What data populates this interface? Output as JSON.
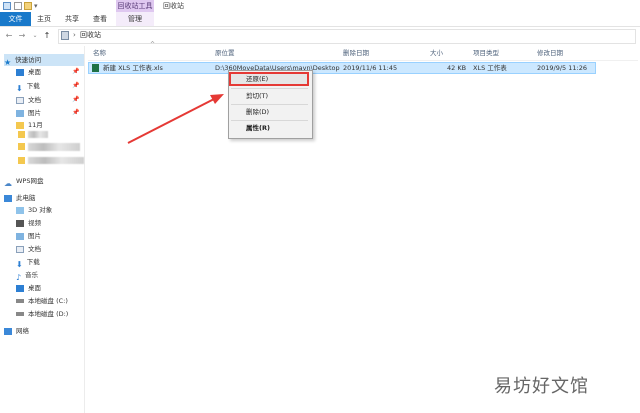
{
  "window": {
    "context_tab_header": "回收站工具",
    "title": "回收站"
  },
  "ribbon": {
    "tabs": [
      {
        "label": "文件"
      },
      {
        "label": "主页"
      },
      {
        "label": "共享"
      },
      {
        "label": "查看"
      },
      {
        "label": "管理"
      }
    ]
  },
  "address": {
    "back_icon": "back-arrow-icon",
    "forward_icon": "forward-arrow-icon",
    "recent_icon": "chevron-down-icon",
    "up_icon": "up-arrow-icon",
    "separator": "›",
    "crumb": "回收站"
  },
  "sidebar": {
    "items": [
      {
        "label": "快速访问",
        "icon": "star-icon"
      },
      {
        "label": "桌面",
        "icon": "desktop-icon",
        "pinned": true
      },
      {
        "label": "下载",
        "icon": "download-icon",
        "pinned": true
      },
      {
        "label": "文档",
        "icon": "document-icon",
        "pinned": true
      },
      {
        "label": "图片",
        "icon": "picture-icon",
        "pinned": true
      },
      {
        "label": "11月",
        "icon": "folder-icon"
      },
      {
        "label": "WPS网盘",
        "icon": "cloud-icon"
      },
      {
        "label": "此电脑",
        "icon": "computer-icon"
      },
      {
        "label": "3D 对象",
        "icon": "3d-object-icon"
      },
      {
        "label": "视频",
        "icon": "video-icon"
      },
      {
        "label": "图片",
        "icon": "picture-icon"
      },
      {
        "label": "文档",
        "icon": "document-icon"
      },
      {
        "label": "下载",
        "icon": "download-icon"
      },
      {
        "label": "音乐",
        "icon": "music-icon"
      },
      {
        "label": "桌面",
        "icon": "desktop-icon"
      },
      {
        "label": "本地磁盘 (C:)",
        "icon": "drive-icon"
      },
      {
        "label": "本地磁盘 (D:)",
        "icon": "drive-icon"
      },
      {
        "label": "网络",
        "icon": "network-icon"
      }
    ],
    "pin_glyph": "📌"
  },
  "columns": [
    "名称",
    "原位置",
    "删除日期",
    "大小",
    "项目类型",
    "修改日期"
  ],
  "files": [
    {
      "name": "新建 XLS 工作表.xls",
      "location": "D:\\360MoveData\\Users\\mayn\\Desktop",
      "deleted": "2019/11/6 11:45",
      "size": "42 KB",
      "type": "XLS 工作表",
      "modified": "2019/9/5 11:26"
    }
  ],
  "context_menu": {
    "items": [
      "还原(E)",
      "剪切(T)",
      "删除(D)",
      "属性(R)"
    ]
  },
  "colors": {
    "accent": "#1979ca",
    "selection": "#cce8ff",
    "highlight_box": "#e53935",
    "manage_tab": "#dfc8f0"
  },
  "watermark": "易坊好文馆"
}
